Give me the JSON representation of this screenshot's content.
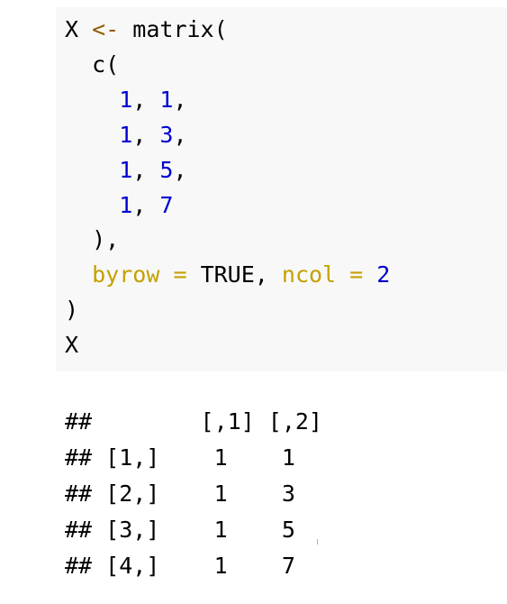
{
  "code": {
    "line1": {
      "var": "X",
      "assign": "<-",
      "fn": "matrix("
    },
    "line2": {
      "text": "c("
    },
    "line3": {
      "a": "1",
      "sep": ",",
      "b": "1",
      "end": ","
    },
    "line4": {
      "a": "1",
      "sep": ",",
      "b": "3",
      "end": ","
    },
    "line5": {
      "a": "1",
      "sep": ",",
      "b": "5",
      "end": ","
    },
    "line6": {
      "a": "1",
      "sep": ",",
      "b": "7"
    },
    "line7": {
      "text": "),"
    },
    "line8": {
      "arg1": "byrow",
      "eq1": "=",
      "val1": "TRUE,",
      "arg2": "ncol",
      "eq2": "=",
      "val2": "2"
    },
    "line9": {
      "text": ")"
    },
    "line10": {
      "text": "X"
    }
  },
  "output": {
    "header": "##        [,1] [,2]",
    "rows": [
      "## [1,]    1    1",
      "## [2,]    1    3",
      "## [3,]    1    5",
      "## [4,]    1    7"
    ]
  },
  "colors": {
    "background": "#ffffff",
    "code_background": "#f8f8f8",
    "operator": "#8f5902",
    "number": "#0000cf",
    "argument": "#c4a000",
    "text": "#000000"
  }
}
